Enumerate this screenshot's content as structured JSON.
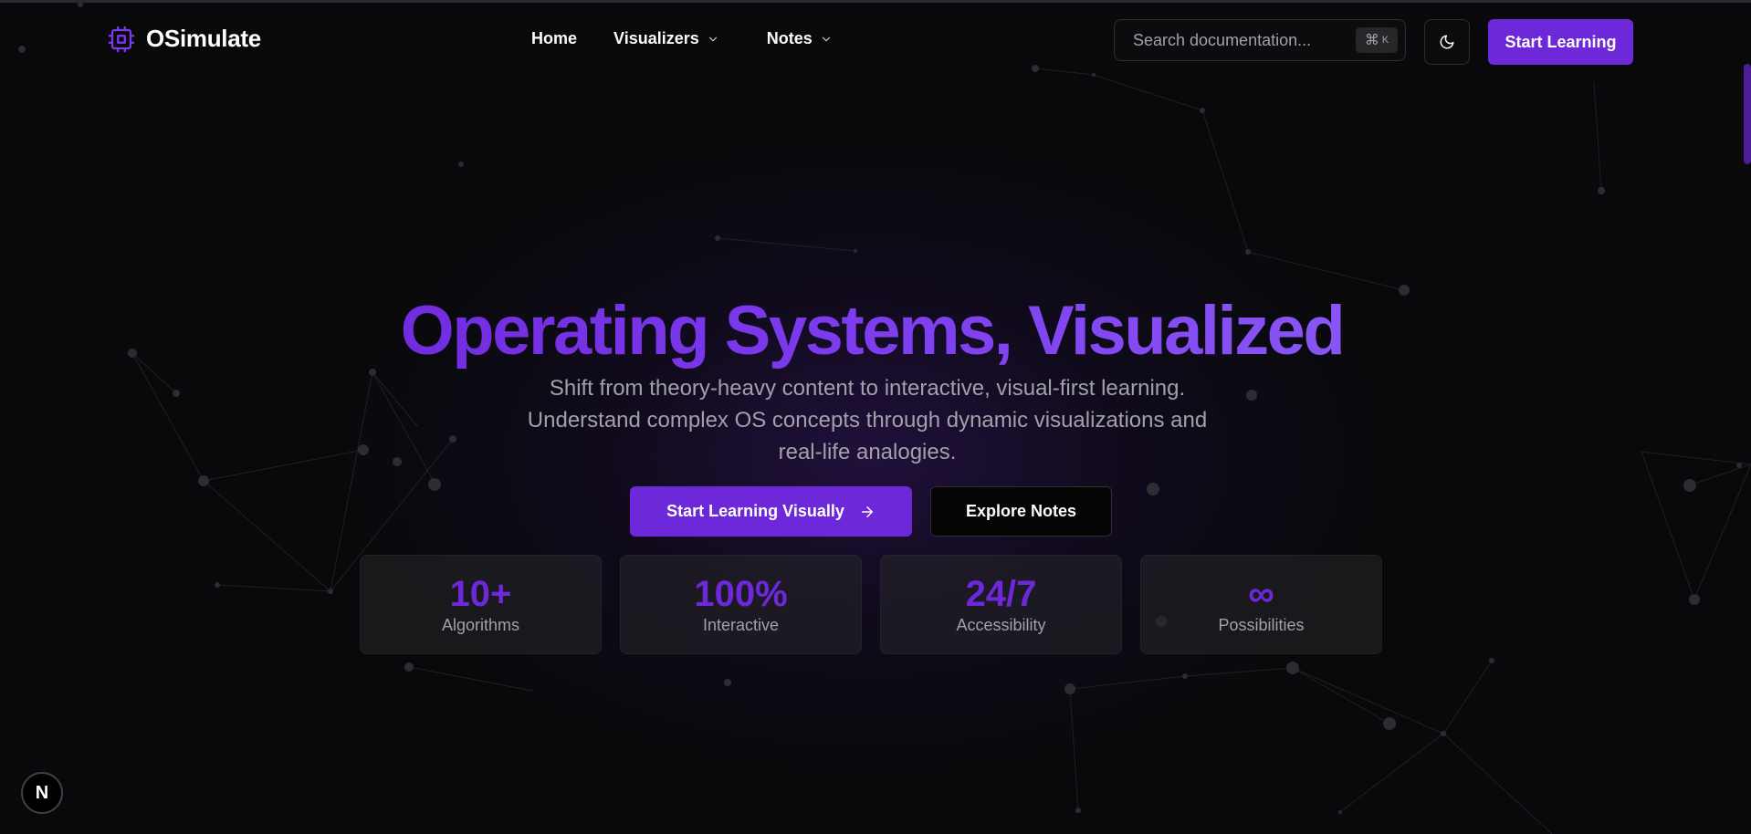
{
  "brand": {
    "name": "OSimulate",
    "icon": "cpu-chip-icon"
  },
  "nav": {
    "home": "Home",
    "visualizers": "Visualizers",
    "notes": "Notes"
  },
  "search": {
    "placeholder": "Search documentation...",
    "shortcut_symbol": "⌘",
    "shortcut_key": "K"
  },
  "header": {
    "theme_toggle_icon": "moon-icon",
    "cta_label": "Start Learning"
  },
  "hero": {
    "title": "Operating Systems, Visualized",
    "subtitle_lines": [
      "Shift from theory-heavy content to interactive, visual-first learning.",
      "Understand complex OS concepts through dynamic visualizations and",
      "real-life analogies."
    ],
    "primary_button": "Start Learning Visually",
    "primary_button_icon": "arrow-right-icon",
    "secondary_button": "Explore Notes"
  },
  "stats": [
    {
      "value": "10+",
      "label": "Algorithms"
    },
    {
      "value": "100%",
      "label": "Interactive"
    },
    {
      "value": "24/7",
      "label": "Accessibility"
    },
    {
      "value": "∞",
      "label": "Possibilities"
    }
  ],
  "badge": {
    "letter": "N"
  },
  "colors": {
    "background": "#09090b",
    "accent": "#6d28d9",
    "accent_light": "#8b5cf6",
    "muted_text": "#a1a1aa"
  }
}
